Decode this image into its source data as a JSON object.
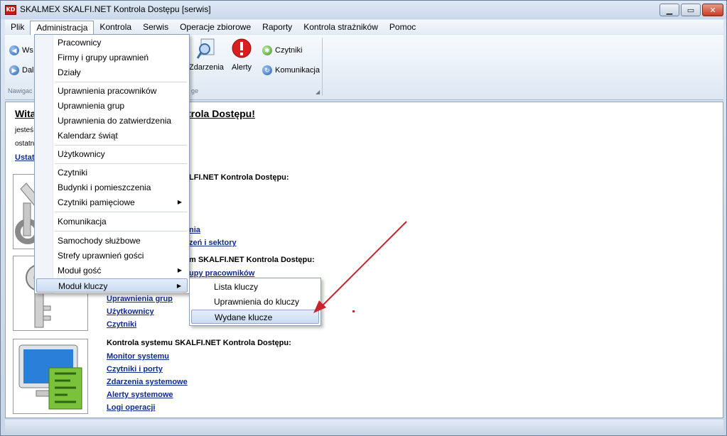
{
  "window": {
    "app_icon_text": "KD",
    "title": "SKALMEX SKALFI.NET Kontrola Dostępu [serwis]",
    "buttons": {
      "minimize": "▁",
      "maximize": "▭",
      "close": "✕"
    }
  },
  "menubar": {
    "items": [
      "Plik",
      "Administracja",
      "Kontrola",
      "Serwis",
      "Operacje zbiorowe",
      "Raporty",
      "Kontrola strażników",
      "Pomoc"
    ],
    "open_item": "Administracja"
  },
  "ribbon": {
    "nav_small_1": "Ws",
    "nav_small_2": "Dal",
    "group_label_nav": "Nawigac",
    "group_label_2": "ge",
    "large_buttons": [
      "Zdarzenia",
      "Alerty"
    ],
    "small_buttons": [
      "Czytniki",
      "Komunikacja"
    ]
  },
  "content": {
    "welcome_start": "Wita",
    "welcome_end": "ntrola Dostępu!",
    "line1": "jesteś",
    "line2": "ostatn",
    "ustaw": "Ustat",
    "section1_heading": "LFI.NET Kontrola Dostępu:",
    "section1_links": [
      "nia",
      "zeń i sektory"
    ],
    "section2_heading": "m SKALFI.NET Kontrola Dostępu:",
    "section2_links": [
      "upy pracowników",
      "Uprawnienia grup",
      "Użytkownicy",
      "Czytniki"
    ],
    "section3_heading": "Kontrola systemu SKALFI.NET Kontrola Dostępu:",
    "section3_links": [
      "Monitor systemu",
      "Czytniki i porty",
      "Zdarzenia systemowe",
      "Alerty systemowe",
      "Logi operacji"
    ]
  },
  "dropdown": {
    "items": [
      {
        "label": "Pracownicy"
      },
      {
        "label": "Firmy i grupy uprawnień"
      },
      {
        "label": "Działy"
      },
      {
        "label": "Uprawnienia pracowników"
      },
      {
        "label": "Uprawnienia grup"
      },
      {
        "label": "Uprawnienia do zatwierdzenia"
      },
      {
        "label": "Kalendarz świąt"
      },
      {
        "label": "Użytkownicy"
      },
      {
        "label": "Czytniki"
      },
      {
        "label": "Budynki i pomieszczenia"
      },
      {
        "label": "Czytniki pamięciowe"
      },
      {
        "label": "Komunikacja"
      },
      {
        "label": "Samochody służbowe"
      },
      {
        "label": "Strefy uprawnień gości"
      },
      {
        "label": "Moduł gość"
      },
      {
        "label": "Moduł kluczy"
      }
    ],
    "submenu_arrow": "▶"
  },
  "submenu": {
    "items": [
      "Lista kluczy",
      "Uprawnienia do kluczy",
      "Wydane klucze"
    ],
    "highlighted": "Wydane klucze"
  },
  "colors": {
    "link": "#102b8c",
    "alert_red": "#d81e1e",
    "annotation_arrow": "#c8242b"
  }
}
